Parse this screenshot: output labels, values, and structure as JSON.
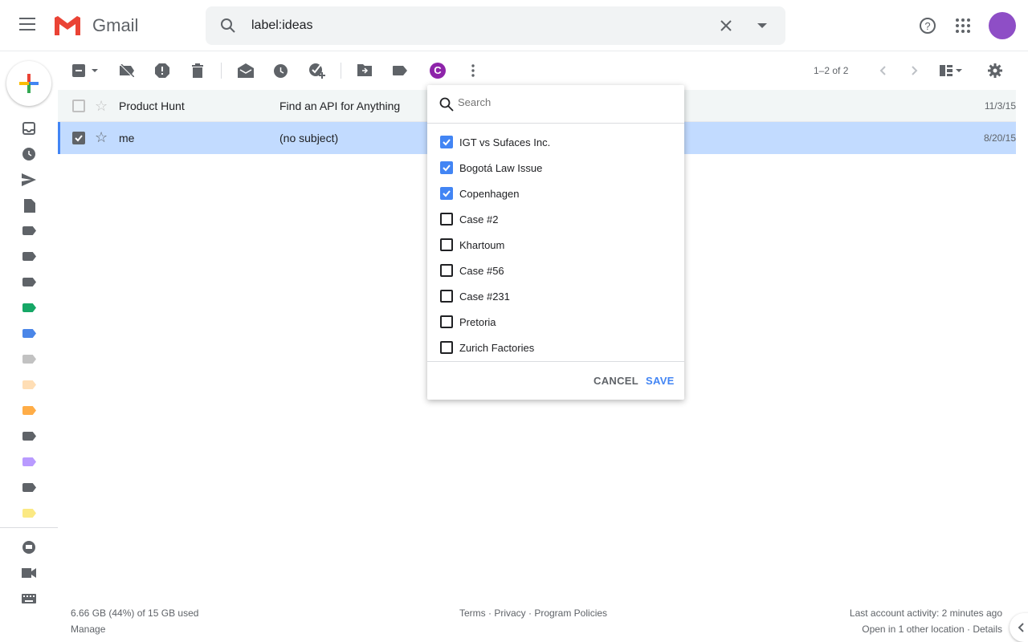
{
  "header": {
    "app_name": "Gmail",
    "search_query": "label:ideas"
  },
  "sidebar": {
    "label_colors": [
      "#5f6368",
      "#5f6368",
      "#5f6368",
      "#16a766",
      "#4a86e8",
      "#c2c2c2",
      "#ffdeb5",
      "#ffad47",
      "#5f6368",
      "#b99aff",
      "#5f6368",
      "#fbe983"
    ]
  },
  "toolbar": {
    "pagination": "1–2 of 2",
    "avatar_letter": "C"
  },
  "emails": [
    {
      "sender": "Product Hunt",
      "subject": "Find an API for Anything",
      "date": "11/3/15",
      "checked": false
    },
    {
      "sender": "me",
      "subject": "(no subject)",
      "date": "8/20/15",
      "checked": true
    }
  ],
  "label_menu": {
    "search_placeholder": "Search",
    "items": [
      {
        "label": "IGT vs Sufaces Inc.",
        "checked": true
      },
      {
        "label": "Bogotá Law Issue",
        "checked": true
      },
      {
        "label": "Copenhagen",
        "checked": true
      },
      {
        "label": "Case #2",
        "checked": false
      },
      {
        "label": "Khartoum",
        "checked": false
      },
      {
        "label": "Case #56",
        "checked": false
      },
      {
        "label": "Case #231",
        "checked": false
      },
      {
        "label": "Pretoria",
        "checked": false
      },
      {
        "label": "Zurich Factories",
        "checked": false
      }
    ],
    "cancel": "CANCEL",
    "save": "SAVE"
  },
  "footer": {
    "storage": "6.66 GB (44%) of 15 GB used",
    "manage": "Manage",
    "terms": "Terms · Privacy · Program Policies",
    "activity": "Last account activity: 2 minutes ago",
    "details": "Open in 1 other location · Details"
  },
  "colors": {
    "accent": "#4285f4",
    "selected_row": "#c2dbff",
    "read_row": "#f2f6f6"
  }
}
